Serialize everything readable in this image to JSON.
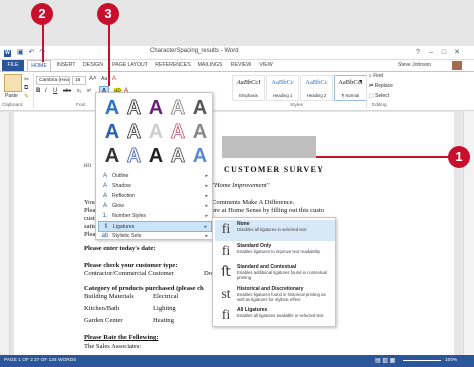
{
  "callouts": [
    "2",
    "3",
    "1"
  ],
  "window": {
    "title": "CharacterSpacing_results - Word",
    "min": "–",
    "max": "□",
    "close": "✕",
    "help": "?"
  },
  "tabs": {
    "file": "FILE",
    "home": "HOME",
    "insert": "INSERT",
    "design": "DESIGN",
    "page_layout": "PAGE LAYOUT",
    "references": "REFERENCES",
    "mailings": "MAILINGS",
    "review": "REVIEW",
    "view": "VIEW",
    "user": "Steve Johnson"
  },
  "ribbon": {
    "paste": "Paste",
    "clipboard": "Clipboard",
    "font_name": "Cambria (Hea",
    "font_size": "16",
    "font_group": "Font",
    "styles_group": "Styles",
    "editing_group": "Editing",
    "find": "Find",
    "replace": "Replace",
    "select": "Select",
    "styles": [
      {
        "sample": "AaBbCcI",
        "name": "Emphasis"
      },
      {
        "sample": "AaBbCc",
        "name": "Heading 1"
      },
      {
        "sample": "AaBbCc",
        "name": "Heading 2"
      },
      {
        "sample": "AaBbCcI",
        "name": "¶ Normal"
      }
    ]
  },
  "effects_gallery": {
    "letter": "A",
    "colors": [
      "#2a73c4",
      "#222222",
      "#6a1f78",
      "#7a7a7a",
      "#555555",
      "#2b62b0",
      "#2a2a2a",
      "#cccccc",
      "#c24d6a",
      "#888888",
      "#333333",
      "#3f63b8",
      "#222222",
      "#444444",
      "#5a8ad6"
    ]
  },
  "effects_menu": [
    {
      "icon": "A",
      "label": "Outline"
    },
    {
      "icon": "A",
      "label": "Shadow"
    },
    {
      "icon": "A",
      "label": "Reflection"
    },
    {
      "icon": "A",
      "label": "Glow"
    },
    {
      "icon": "1.",
      "label": "Number Styles"
    },
    {
      "icon": "fi",
      "label": "Ligatures"
    },
    {
      "icon": "ab",
      "label": "Stylistic Sets"
    }
  ],
  "ligatures": [
    {
      "glyph": "fi",
      "title": "None",
      "desc": "Disables all ligatures in selected text"
    },
    {
      "glyph": "fi",
      "title": "Standard Only",
      "desc": "Enables ligatures to improve text readability"
    },
    {
      "glyph": "ﬅ",
      "title": "Standard and Contextual",
      "desc": "Enables additional ligatures found in contextual printing"
    },
    {
      "glyph": "st",
      "title": "Historical and Discretionary",
      "desc": "Enables ligatures found in historical printing as well as ligatures for stylistic effect"
    },
    {
      "glyph": "fi",
      "title": "All Ligatures",
      "desc": "Enables all ligatures available in selected text"
    }
  ],
  "document": {
    "survey_title": "CUSTOMER SURVEY",
    "tagline": "\"Home Improvement\"",
    "intro1": "Comments Make A Difference.",
    "intro2": "ere at Home Sense by filling out this custo",
    "intro3": "...sidoring a ann aveallont ou",
    "left_frag": [
      "Your",
      "Plea",
      "custor",
      "satis",
      "Plea",
      "Than"
    ],
    "date_label": "Please enter today's date:",
    "check_label": "Please check your customer type:",
    "check_item": "Contractor/Commercial Customer",
    "check_item2": "Do",
    "category_label": "Category of products purchased (please ch",
    "cat_rows": [
      [
        "Building Materials",
        "Electrical"
      ],
      [
        "Kitchen/Bath",
        "Lighting"
      ],
      [
        "Garden Center",
        "Heating"
      ]
    ],
    "rate_label": "Please Rate the Following:",
    "rate_item": "The Sales Associates:"
  },
  "status": {
    "page": "PAGE 1 OF 2",
    "words": "27 OF 134 WORDS",
    "zoom": "100%"
  }
}
